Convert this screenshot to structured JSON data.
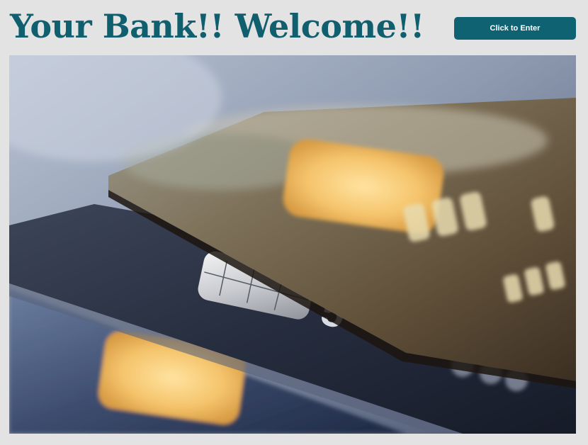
{
  "header": {
    "title": "Your Bank!! Welcome!!",
    "enter_button_label": "Click to Enter"
  },
  "hero": {
    "image_subject": "credit-cards-photo",
    "card_number_glyph": "5"
  },
  "colors": {
    "background": "#e3e3e3",
    "brand": "#0f5f6f",
    "button": "#0f6272",
    "button_text": "#ffffff"
  }
}
